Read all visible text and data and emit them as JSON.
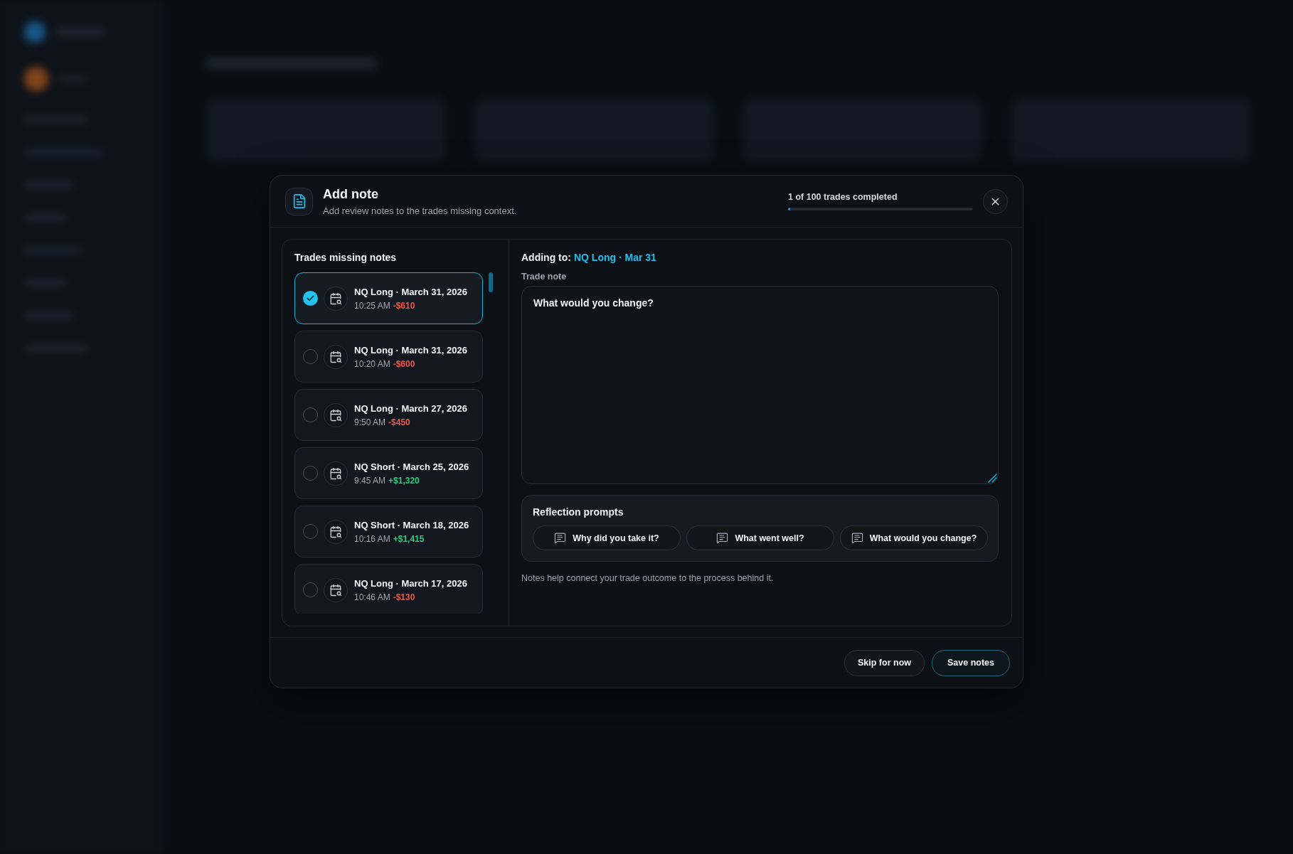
{
  "dialog": {
    "title": "Add note",
    "subtitle": "Add review notes to the trades missing context.",
    "progress": {
      "label": "1 of 100 trades completed",
      "level": 0.01
    }
  },
  "trade_list": {
    "title": "Trades missing notes",
    "items": [
      {
        "title": "NQ Long · March 31, 2026",
        "time": "10:25 AM",
        "pnl": "-$610",
        "color": "#f0564a",
        "selected": true
      },
      {
        "title": "NQ Long · March 31, 2026",
        "time": "10:20 AM",
        "pnl": "-$600",
        "color": "#f0564a",
        "selected": false
      },
      {
        "title": "NQ Long · March 27, 2026",
        "time": "9:50 AM",
        "pnl": "-$450",
        "color": "#f0564a",
        "selected": false
      },
      {
        "title": "NQ Short · March 25, 2026",
        "time": "9:45 AM",
        "pnl": "+$1,320",
        "color": "#2ccf7c",
        "selected": false
      },
      {
        "title": "NQ Short · March 18, 2026",
        "time": "10:16 AM",
        "pnl": "+$1,415",
        "color": "#2ccf7c",
        "selected": false
      },
      {
        "title": "NQ Long · March 17, 2026",
        "time": "10:46 AM",
        "pnl": "-$130",
        "color": "#f0564a",
        "selected": false
      }
    ]
  },
  "editor": {
    "adding_to_label": "Adding to:",
    "adding_to_value": "NQ Long · Mar 31",
    "field_label": "Trade note",
    "value": "What would you change?"
  },
  "prompts": {
    "title": "Reflection prompts",
    "items": [
      "Why did you take it?",
      "What went well?",
      "What would you change?"
    ]
  },
  "hint": "Notes help connect your trade outcome to the process behind it.",
  "buttons": [
    {
      "label": "Skip for now",
      "kind": "secondary"
    },
    {
      "label": "Save notes",
      "kind": "primary"
    }
  ]
}
